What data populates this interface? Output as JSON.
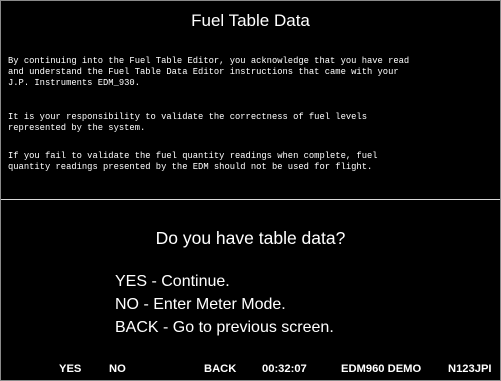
{
  "screen": {
    "title": "Fuel Table Data",
    "notice": [
      "By continuing into the Fuel Table Editor, you acknowledge that you have read\nand understand the Fuel Table Data Editor instructions that came with your\nJ.P. Instruments EDM_930.",
      "It is your responsibility to validate the correctness of fuel levels\nrepresented by the system.",
      "If you fail to validate the fuel quantity readings when complete, fuel\nquantity readings presented by the EDM should not be used for flight."
    ],
    "question": "Do you have table data?",
    "options": [
      "YES - Continue.",
      "NO - Enter Meter Mode.",
      "BACK - Go to previous screen."
    ]
  },
  "softkeys": {
    "yes": "YES",
    "no": "NO",
    "back": "BACK"
  },
  "status": {
    "time": "00:32:07",
    "model": "EDM960 DEMO",
    "tail_number": "N123JPI"
  },
  "colors": {
    "background": "#000000",
    "text": "#ffffff",
    "divider": "#d8d8d8"
  }
}
